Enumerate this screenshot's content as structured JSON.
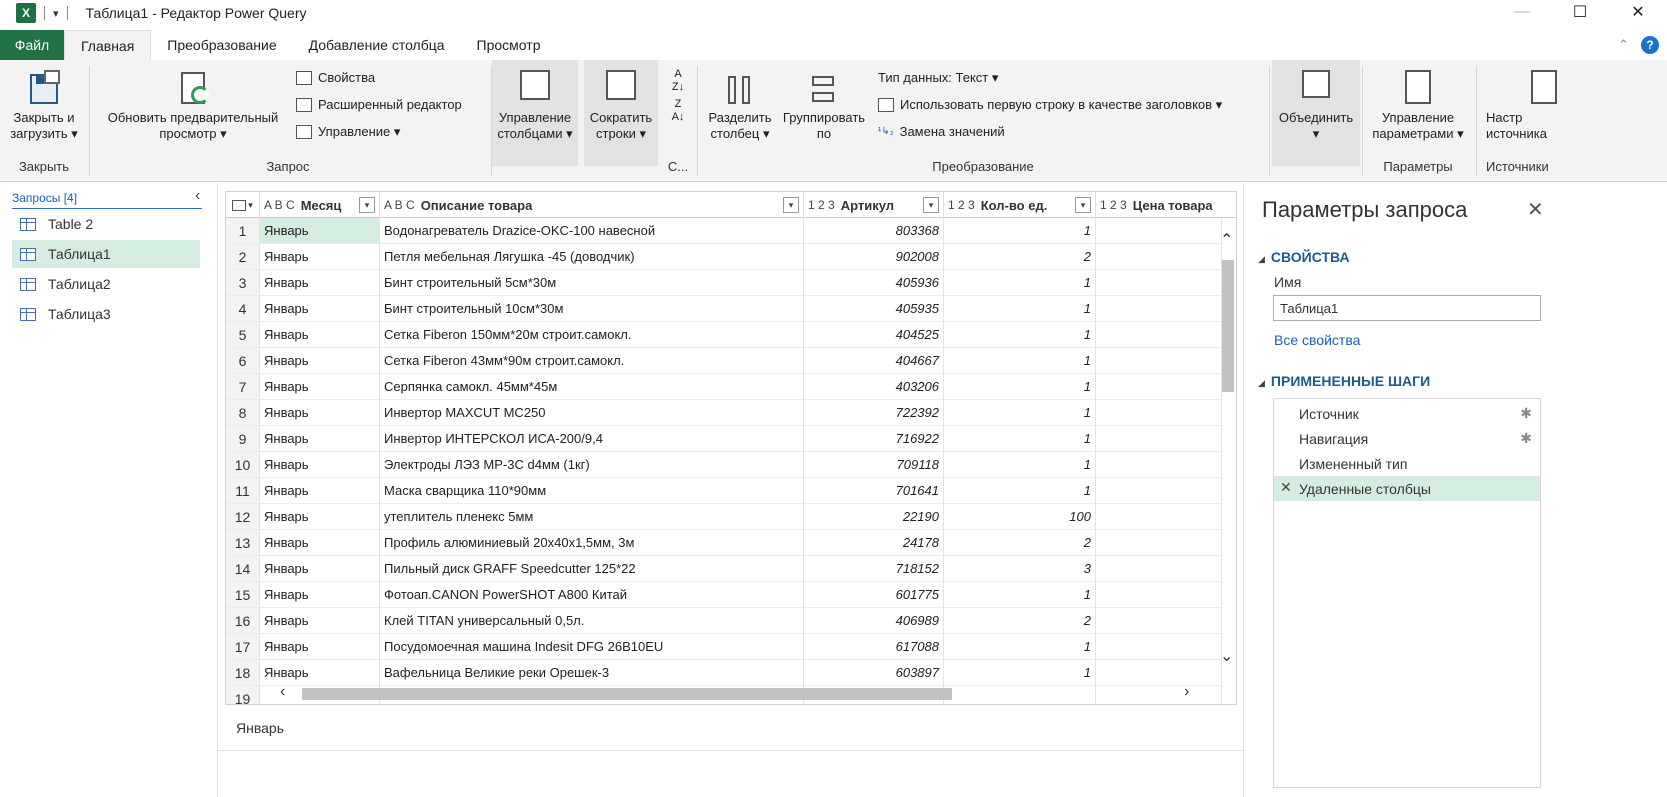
{
  "window": {
    "app_icon": "X",
    "title": "Таблица1 - Редактор Power Query",
    "minimize": "—",
    "maximize": "☐",
    "close": "✕"
  },
  "tabs": [
    "Файл",
    "Главная",
    "Преобразование",
    "Добавление столбца",
    "Просмотр"
  ],
  "ribbon": {
    "close_load": "Закрыть и\nзагрузить ▾",
    "group_close": "Закрыть",
    "refresh": "Обновить предварительный\nпросмотр ▾",
    "properties": "Свойства",
    "advanced_editor": "Расширенный редактор",
    "manage": "Управление ▾",
    "group_query": "Запрос",
    "manage_columns": "Управление\nстолбцами ▾",
    "reduce_rows": "Сократить\nстроки ▾",
    "group_sort": "С...",
    "split_column": "Разделить\nстолбец ▾",
    "group_by": "Группировать\nпо",
    "data_type": "Тип данных: Текст ▾",
    "use_first_row": "Использовать первую строку в качестве заголовков ▾",
    "replace_values": "Замена значений",
    "group_transform": "Преобразование",
    "combine": "Объединить\n▾",
    "manage_params": "Управление\nпараметрами ▾",
    "group_params": "Параметры",
    "data_source": "Настр\nисточника",
    "group_sources": "Источники"
  },
  "queries": {
    "header": "Запросы [4]",
    "items": [
      "Table 2",
      "Таблица1",
      "Таблица2",
      "Таблица3"
    ],
    "selected": "Таблица1"
  },
  "grid": {
    "columns": [
      {
        "type": "A B C",
        "name": "Месяц"
      },
      {
        "type": "A B C",
        "name": "Описание товара"
      },
      {
        "type": "1 2 3",
        "name": "Артикул"
      },
      {
        "type": "1 2 3",
        "name": "Кол-во ед."
      },
      {
        "type": "1 2 3",
        "name": "Цена товара"
      }
    ],
    "rows": [
      {
        "n": "1",
        "month": "Январь",
        "desc": "Водонагреватель Drazice-OKC-100 навесной",
        "art": "803368",
        "qty": "1"
      },
      {
        "n": "2",
        "month": "Январь",
        "desc": "Петля мебельная Лягушка -45 (доводчик)",
        "art": "902008",
        "qty": "2"
      },
      {
        "n": "3",
        "month": "Январь",
        "desc": "Бинт строительный 5см*30м",
        "art": "405936",
        "qty": "1"
      },
      {
        "n": "4",
        "month": "Январь",
        "desc": "Бинт строительный 10см*30м",
        "art": "405935",
        "qty": "1"
      },
      {
        "n": "5",
        "month": "Январь",
        "desc": "Сетка  Fiberon 150мм*20м строит.самокл.",
        "art": "404525",
        "qty": "1"
      },
      {
        "n": "6",
        "month": "Январь",
        "desc": "Сетка Fiberon 43мм*90м строит.самокл.",
        "art": "404667",
        "qty": "1"
      },
      {
        "n": "7",
        "month": "Январь",
        "desc": "Серпянка самокл. 45мм*45м",
        "art": "403206",
        "qty": "1"
      },
      {
        "n": "8",
        "month": "Январь",
        "desc": "Инвертор MAXCUT MC250",
        "art": "722392",
        "qty": "1"
      },
      {
        "n": "9",
        "month": "Январь",
        "desc": "Инвертор  ИНТЕРСКОЛ ИСА-200/9,4",
        "art": "716922",
        "qty": "1"
      },
      {
        "n": "10",
        "month": "Январь",
        "desc": "Электроды ЛЭЗ МР-3С  d4мм (1кг)",
        "art": "709118",
        "qty": "1"
      },
      {
        "n": "11",
        "month": "Январь",
        "desc": "Маска сварщика 110*90мм",
        "art": "701641",
        "qty": "1"
      },
      {
        "n": "12",
        "month": "Январь",
        "desc": "утеплитель пленекс 5мм",
        "art": "22190",
        "qty": "100"
      },
      {
        "n": "13",
        "month": "Январь",
        "desc": "Профиль алюминиевый 20х40х1,5мм,  3м",
        "art": "24178",
        "qty": "2"
      },
      {
        "n": "14",
        "month": "Январь",
        "desc": "Пильный диск GRAFF Speedcutter 125*22",
        "art": "718152",
        "qty": "3"
      },
      {
        "n": "15",
        "month": "Январь",
        "desc": "Фотоап.CANON PowerSHOT A800 Китай",
        "art": "601775",
        "qty": "1"
      },
      {
        "n": "16",
        "month": "Январь",
        "desc": "Клей TITAN  универсальный 0,5л.",
        "art": "406989",
        "qty": "2"
      },
      {
        "n": "17",
        "month": "Январь",
        "desc": "Посудомоечная машина Indesit DFG 26B10EU",
        "art": "617088",
        "qty": "1"
      },
      {
        "n": "18",
        "month": "Январь",
        "desc": "Вафельница Великие реки Орешек-3",
        "art": "603897",
        "qty": "1"
      },
      {
        "n": "19",
        "month": "",
        "desc": "",
        "art": "",
        "qty": ""
      }
    ],
    "preview_value": "Январь"
  },
  "settings": {
    "title": "Параметры запроса",
    "properties_header": "СВОЙСТВА",
    "name_label": "Имя",
    "name_value": "Таблица1",
    "all_properties": "Все свойства",
    "steps_header": "ПРИМЕНЕННЫЕ ШАГИ",
    "steps": [
      "Источник",
      "Навигация",
      "Измененный тип",
      "Удаленные столбцы"
    ],
    "selected_step": "Удаленные столбцы"
  },
  "colors": {
    "file_tab": "#217346",
    "selection": "#d5ede0",
    "section_header": "#1e5a8a",
    "link": "#1a5fb4"
  }
}
